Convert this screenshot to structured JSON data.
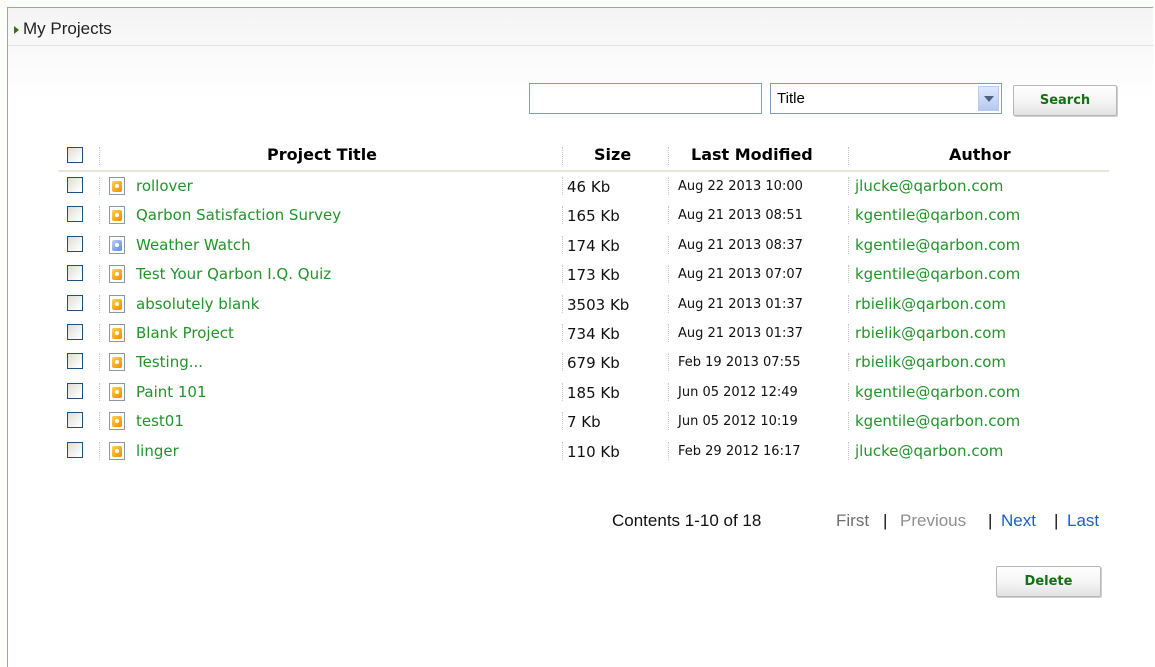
{
  "panel": {
    "title": "My Projects"
  },
  "search": {
    "input_value": "",
    "field_selected": "Title",
    "button_label": "Search"
  },
  "table": {
    "columns": [
      "Project Title",
      "Size",
      "Last Modified",
      "Author"
    ],
    "rows": [
      {
        "title": "rollover",
        "size": "46 Kb",
        "modified": "Aug 22 2013 10:00",
        "author": "jlucke@qarbon.com",
        "icon": "captivate-project-icon"
      },
      {
        "title": "Qarbon Satisfaction Survey",
        "size": "165 Kb",
        "modified": "Aug 21 2013 08:51",
        "author": "kgentile@qarbon.com",
        "icon": "captivate-project-icon"
      },
      {
        "title": "Weather Watch",
        "size": "174 Kb",
        "modified": "Aug 21 2013 08:37",
        "author": "kgentile@qarbon.com",
        "icon": "blue-project-icon"
      },
      {
        "title": "Test Your Qarbon I.Q. Quiz",
        "size": "173 Kb",
        "modified": "Aug 21 2013 07:07",
        "author": "kgentile@qarbon.com",
        "icon": "captivate-project-icon"
      },
      {
        "title": "absolutely blank",
        "size": "3503 Kb",
        "modified": "Aug 21 2013 01:37",
        "author": "rbielik@qarbon.com",
        "icon": "captivate-project-icon"
      },
      {
        "title": "Blank Project",
        "size": "734 Kb",
        "modified": "Aug 21 2013 01:37",
        "author": "rbielik@qarbon.com",
        "icon": "captivate-project-icon"
      },
      {
        "title": "Testing...",
        "size": "679 Kb",
        "modified": "Feb 19 2013 07:55",
        "author": "rbielik@qarbon.com",
        "icon": "captivate-project-icon"
      },
      {
        "title": "Paint 101",
        "size": "185 Kb",
        "modified": "Jun 05 2012 12:49",
        "author": "kgentile@qarbon.com",
        "icon": "captivate-project-icon"
      },
      {
        "title": "test01",
        "size": "7 Kb",
        "modified": "Jun 05 2012 10:19",
        "author": "kgentile@qarbon.com",
        "icon": "captivate-project-icon"
      },
      {
        "title": "linger",
        "size": "110 Kb",
        "modified": "Feb 29 2012 16:17",
        "author": "jlucke@qarbon.com",
        "icon": "captivate-project-icon"
      }
    ]
  },
  "pagination": {
    "summary": "Contents 1-10 of 18",
    "first": "First",
    "previous": "Previous",
    "next": "Next",
    "last": "Last",
    "separator": "|"
  },
  "actions": {
    "delete_label": "Delete"
  },
  "colors": {
    "link_green": "#22942a",
    "link_blue": "#1c5fc4",
    "frame_green": "#59d659"
  }
}
